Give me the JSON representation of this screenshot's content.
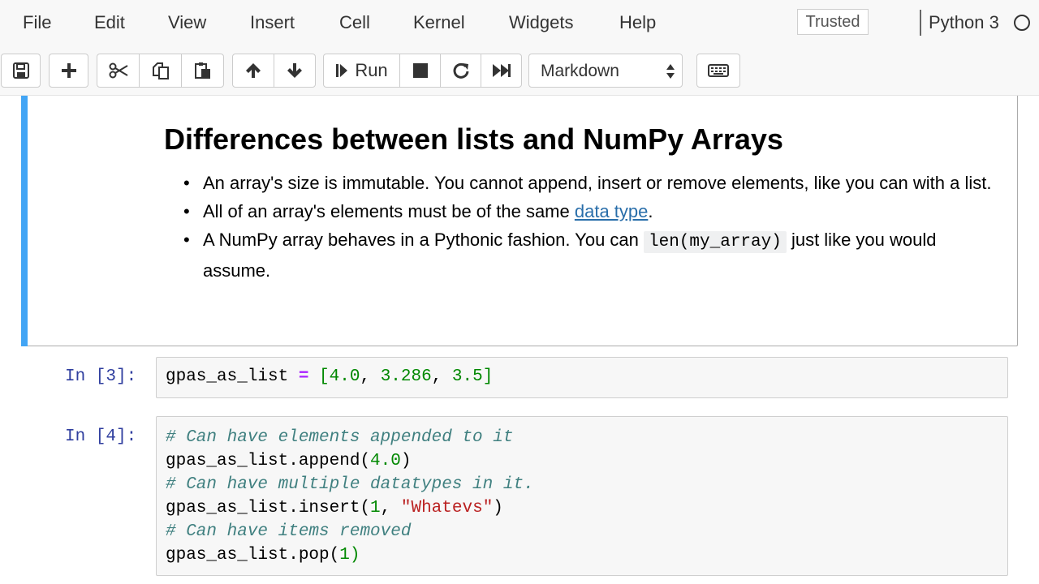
{
  "menubar": {
    "items": [
      "File",
      "Edit",
      "View",
      "Insert",
      "Cell",
      "Kernel",
      "Widgets",
      "Help"
    ],
    "trusted_label": "Trusted",
    "kernel_name": "Python 3"
  },
  "toolbar": {
    "run_label": "Run",
    "cell_type": "Markdown",
    "buttons": [
      "save-icon",
      "plus-icon",
      "scissors-icon",
      "copy-icon",
      "paste-icon",
      "arrow-up-icon",
      "arrow-down-icon",
      "run-icon",
      "stop-icon",
      "restart-icon",
      "fast-forward-icon",
      "keyboard-icon"
    ]
  },
  "markdown_cell": {
    "heading": "Differences between lists and NumPy Arrays",
    "bullets": [
      {
        "text": "An array's size is immutable. You cannot append, insert or remove elements, like you can with a list."
      },
      {
        "before": "All of an array's elements must be of the same ",
        "link": "data type",
        "after": "."
      },
      {
        "before": "A NumPy array behaves in a Pythonic fashion. You can ",
        "code": "len(my_array)",
        "after": " just like you would assume."
      }
    ]
  },
  "code_cells": [
    {
      "prompt": "In [3]:",
      "lines": [
        [
          {
            "t": "gpas_as_list ",
            "c": ""
          },
          {
            "t": "=",
            "c": "op"
          },
          {
            "t": " ",
            "c": ""
          },
          {
            "t": "[",
            "c": "num"
          },
          {
            "t": "4.0",
            "c": "num"
          },
          {
            "t": ", ",
            "c": ""
          },
          {
            "t": "3.286",
            "c": "num"
          },
          {
            "t": ", ",
            "c": ""
          },
          {
            "t": "3.5",
            "c": "num"
          },
          {
            "t": "]",
            "c": "num"
          }
        ]
      ]
    },
    {
      "prompt": "In [4]:",
      "lines": [
        [
          {
            "t": "# Can have elements appended to it",
            "c": "cm"
          }
        ],
        [
          {
            "t": "gpas_as_list.append(",
            "c": ""
          },
          {
            "t": "4.0",
            "c": "num"
          },
          {
            "t": ")",
            "c": ""
          }
        ],
        [
          {
            "t": "# Can have multiple datatypes in it.",
            "c": "cm"
          }
        ],
        [
          {
            "t": "gpas_as_list.insert(",
            "c": ""
          },
          {
            "t": "1",
            "c": "num"
          },
          {
            "t": ", ",
            "c": ""
          },
          {
            "t": "\"Whatevs\"",
            "c": "str"
          },
          {
            "t": ")",
            "c": ""
          }
        ],
        [
          {
            "t": "# Can have items removed",
            "c": "cm"
          }
        ],
        [
          {
            "t": "gpas_as_list.pop(",
            "c": ""
          },
          {
            "t": "1",
            "c": "num"
          },
          {
            "t": ")",
            "c": "num"
          }
        ]
      ]
    }
  ]
}
